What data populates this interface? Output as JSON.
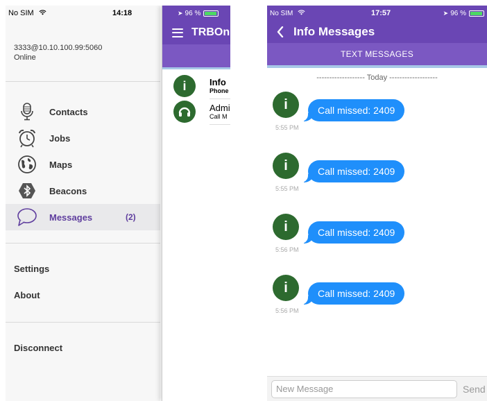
{
  "left": {
    "status": {
      "carrier": "No SIM",
      "time": "14:18"
    },
    "account": {
      "address": "3333@10.10.100.99:5060",
      "state": "Online"
    },
    "menu": [
      {
        "label": "Contacts",
        "icon": "microphone-icon"
      },
      {
        "label": "Jobs",
        "icon": "alarm-clock-icon"
      },
      {
        "label": "Maps",
        "icon": "globe-icon"
      },
      {
        "label": "Beacons",
        "icon": "bluetooth-icon"
      },
      {
        "label": "Messages",
        "icon": "chat-bubble-icon",
        "badge": "(2)"
      }
    ],
    "settings_label": "Settings",
    "about_label": "About",
    "disconnect_label": "Disconnect",
    "behind": {
      "status": "96 %",
      "brand": "TRBOn",
      "conversations": [
        {
          "name": "Info",
          "sub": "Phone",
          "icon": "info-icon"
        },
        {
          "name": "Admi",
          "sub": "Call M",
          "icon": "headset-icon"
        }
      ]
    }
  },
  "right": {
    "status": {
      "carrier": "No SIM",
      "time": "17:57",
      "battery": "96 %"
    },
    "title": "Info Messages",
    "tab": "TEXT MESSAGES",
    "day_separator": "------------------- Today -------------------",
    "messages": [
      {
        "text": "Call missed: 2409",
        "time": "5:55 PM"
      },
      {
        "text": "Call missed: 2409",
        "time": "5:55 PM"
      },
      {
        "text": "Call missed: 2409",
        "time": "5:56 PM"
      },
      {
        "text": "Call missed: 2409",
        "time": "5:56 PM"
      }
    ],
    "composer": {
      "placeholder": "New Message",
      "send_label": "Send"
    }
  },
  "colors": {
    "brand_purple": "#6a46b4",
    "tab_purple": "#7b58c2",
    "bubble_blue": "#1f8ffb",
    "avatar_green": "#2d6a2f",
    "active_label": "#5f3e9e"
  }
}
